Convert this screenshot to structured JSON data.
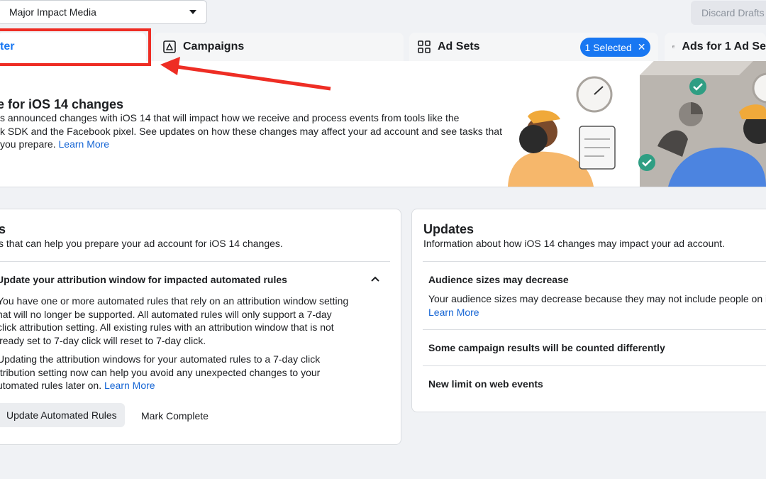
{
  "account": {
    "name": "Major Impact Media"
  },
  "toolbar": {
    "discard_label": "Discard Drafts"
  },
  "tabs": [
    {
      "label": "ter"
    },
    {
      "label": "Campaigns"
    },
    {
      "label": "Ad Sets"
    },
    {
      "label": "Ads for 1 Ad Se"
    }
  ],
  "selection": {
    "label": "1 Selected"
  },
  "banner": {
    "title": "e for iOS 14 changes",
    "line1": "s announced changes with iOS 14 that will impact how we receive and process events from tools like the",
    "line2": "k SDK and the Facebook pixel. See updates on how these changes may affect your ad account and see tasks that",
    "line3": "you prepare. ",
    "link": "Learn More"
  },
  "tasks": {
    "title": "s",
    "subtitle": "s that can help you prepare your ad account for iOS 14 changes.",
    "item_title": "Update your attribution window for impacted automated rules",
    "p1": [
      "You have one or more automated rules that rely on an attribution window setting",
      "hat will no longer be supported. All automated rules will only support a 7-day",
      "click attribution setting. All existing rules with an attribution window that is not",
      "lready set to 7-day click will reset to 7-day click."
    ],
    "p2": [
      "Updating the attribution windows for your automated rules to a 7-day click",
      "ttribution setting now can help you avoid any unexpected changes to your"
    ],
    "p2_last": "utomated rules later on. ",
    "link": "Learn More",
    "primary_button": "Update Automated Rules",
    "secondary_button": "Mark Complete"
  },
  "updates": {
    "title": "Updates",
    "subtitle": "Information about how iOS 14 changes may impact your ad account.",
    "items": [
      {
        "title": "Audience sizes may decrease",
        "text": "Your audience sizes may decrease because they may not include people on iOS",
        "link": "Learn More"
      },
      {
        "title": "Some campaign results will be counted differently"
      },
      {
        "title": "New limit on web events"
      }
    ]
  },
  "colors": {
    "accent": "#1877f2",
    "highlight": "#ee2d24",
    "background": "#f0f2f5"
  }
}
